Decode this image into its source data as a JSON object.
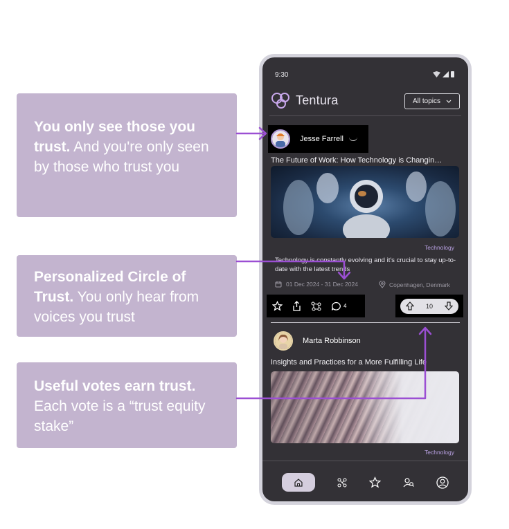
{
  "callouts": [
    {
      "bold": "You only see those you trust.",
      "text": " And you're only seen by those who trust you"
    },
    {
      "bold": "Personalized Circle of Trust.",
      "text": " You only hear from voices you trust"
    },
    {
      "bold": "Useful votes earn trust.",
      "text": " Each vote is a “trust equity stake”"
    }
  ],
  "status": {
    "time": "9:30"
  },
  "app": {
    "name": "Tentura",
    "topic_filter": "All topics"
  },
  "posts": [
    {
      "author": "Jesse Farrell",
      "title": "The Future of Work: How Technology is Changin…",
      "tag": "Technology",
      "description": "Technology is constantly evolving and it's crucial to stay up-to-date with the latest trends",
      "date_range": "01 Dec 2024 - 31 Dec 2024",
      "location": "Copenhagen, Denmark",
      "comments": "4",
      "votes": "10"
    },
    {
      "author": "Marta Robbinson",
      "title": "Insights and Practices for a More Fulfilling Life",
      "tag": "Technology"
    }
  ],
  "colors": {
    "callout_bg": "#c3b4cf",
    "accent": "#9b4fd3",
    "screen_bg": "#333136"
  },
  "icons": [
    "home-icon",
    "graph-icon",
    "star-icon",
    "friends-icon",
    "profile-icon"
  ]
}
